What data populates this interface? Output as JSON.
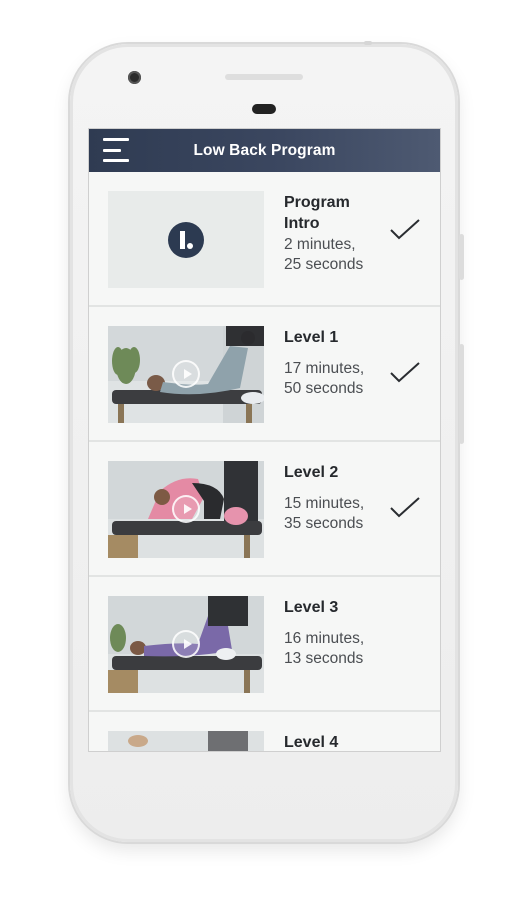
{
  "app": {
    "title": "Low Back Program"
  },
  "colors": {
    "appbar": "#34405a",
    "accent_logo": "#2c3a51",
    "text_primary": "#26292d",
    "text_secondary": "#4b4e52"
  },
  "icons": {
    "menu": "hamburger-menu-icon",
    "complete": "checkmark-icon",
    "play": "play-icon",
    "brand": "brand-logo-icon"
  },
  "items": [
    {
      "title": "Program\nIntro",
      "duration": "2 minutes,\n25 seconds",
      "completed": true
    },
    {
      "title": "Level 1",
      "duration": "17 minutes,\n50 seconds",
      "completed": true
    },
    {
      "title": "Level 2",
      "duration": "15 minutes,\n35 seconds",
      "completed": true
    },
    {
      "title": "Level 3",
      "duration": "16 minutes,\n13 seconds",
      "completed": false
    },
    {
      "title": "Level 4",
      "duration": "",
      "completed": false
    }
  ]
}
